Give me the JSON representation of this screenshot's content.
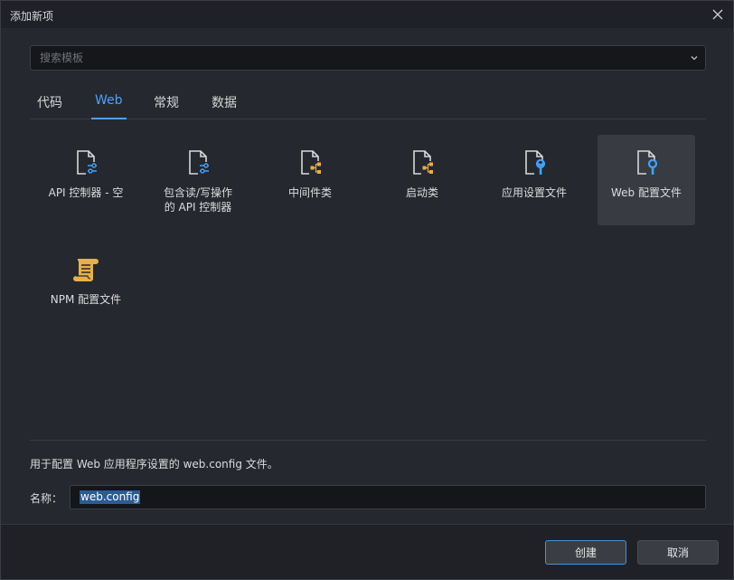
{
  "window": {
    "title": "添加新项"
  },
  "search": {
    "placeholder": "搜索模板",
    "value": ""
  },
  "tabs": [
    {
      "label": "代码",
      "active": false
    },
    {
      "label": "Web",
      "active": true
    },
    {
      "label": "常规",
      "active": false
    },
    {
      "label": "数据",
      "active": false
    }
  ],
  "templates": [
    {
      "label": "API 控制器 - 空",
      "icon": "document-settings-icon",
      "selected": false
    },
    {
      "label": "包含读/写操作\n的 API 控制器",
      "icon": "document-settings-icon",
      "selected": false
    },
    {
      "label": "中间件类",
      "icon": "document-hierarchy-icon",
      "selected": false
    },
    {
      "label": "启动类",
      "icon": "document-hierarchy-icon",
      "selected": false
    },
    {
      "label": "应用设置文件",
      "icon": "document-wrench-icon",
      "selected": false
    },
    {
      "label": "Web 配置文件",
      "icon": "document-wrench-icon",
      "selected": true
    },
    {
      "label": "NPM 配置文件",
      "icon": "scroll-icon",
      "selected": false
    }
  ],
  "description": "用于配置 Web 应用程序设置的 web.config 文件。",
  "name": {
    "label": "名称：",
    "value": "web.config"
  },
  "buttons": {
    "create": "创建",
    "cancel": "取消"
  },
  "colors": {
    "accent": "#4ea1ff",
    "icon_blue": "#3fa4ff",
    "icon_orange": "#e8b04a"
  }
}
